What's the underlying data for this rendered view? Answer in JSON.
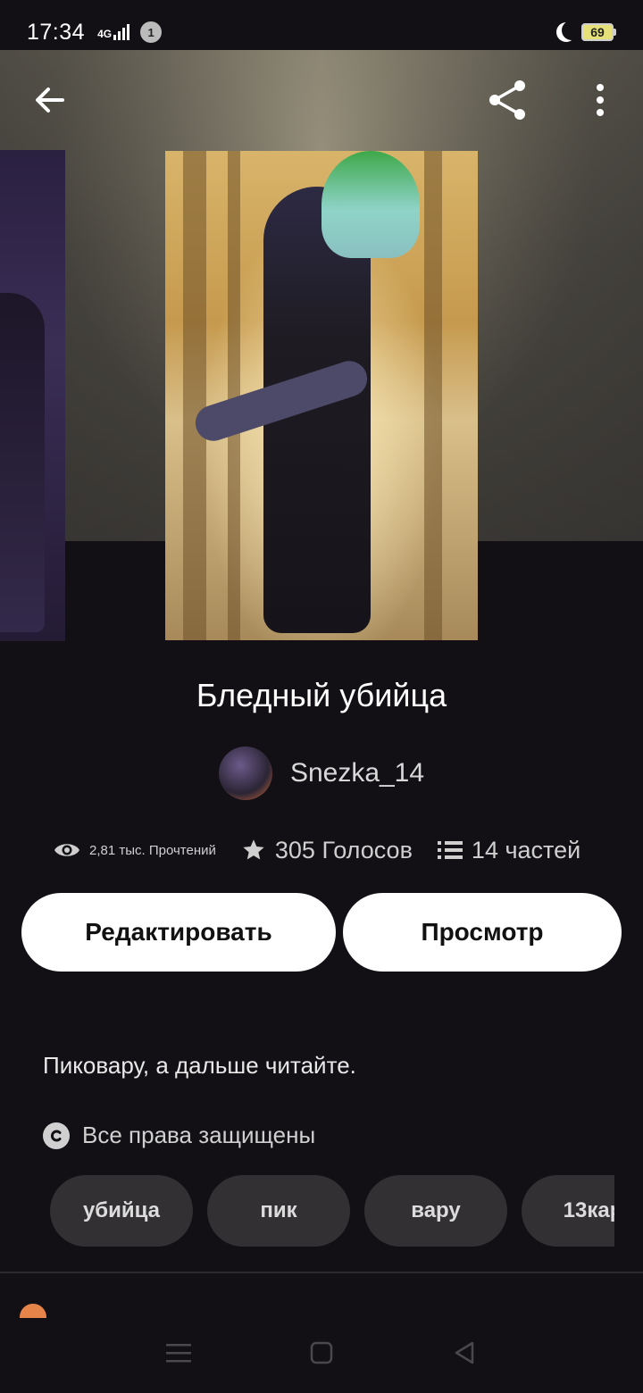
{
  "status_bar": {
    "time": "17:34",
    "network": "4G",
    "notification_count": "1",
    "battery": "69"
  },
  "story": {
    "title": "Бледный убийца",
    "author": "Snezka_14",
    "reads": "2,81 тыс. Прочтений",
    "votes": "305 Голосов",
    "parts": "14 частей",
    "description": "Пиковару, а дальше читайте.",
    "copyright": "Все права защищены"
  },
  "actions": {
    "edit_label": "Редактировать",
    "view_label": "Просмотр"
  },
  "tags": [
    "убийца",
    "пик",
    "вару",
    "13кар"
  ],
  "icons": {
    "back": "arrow-left-icon",
    "share": "share-icon",
    "more": "more-vertical-icon",
    "reads": "eye-icon",
    "votes": "star-icon",
    "parts": "list-icon",
    "copyright": "copyright-icon"
  },
  "colors": {
    "background": "#121014",
    "button_bg": "#ffffff",
    "tag_bg": "#333034",
    "battery": "#e5e178"
  }
}
